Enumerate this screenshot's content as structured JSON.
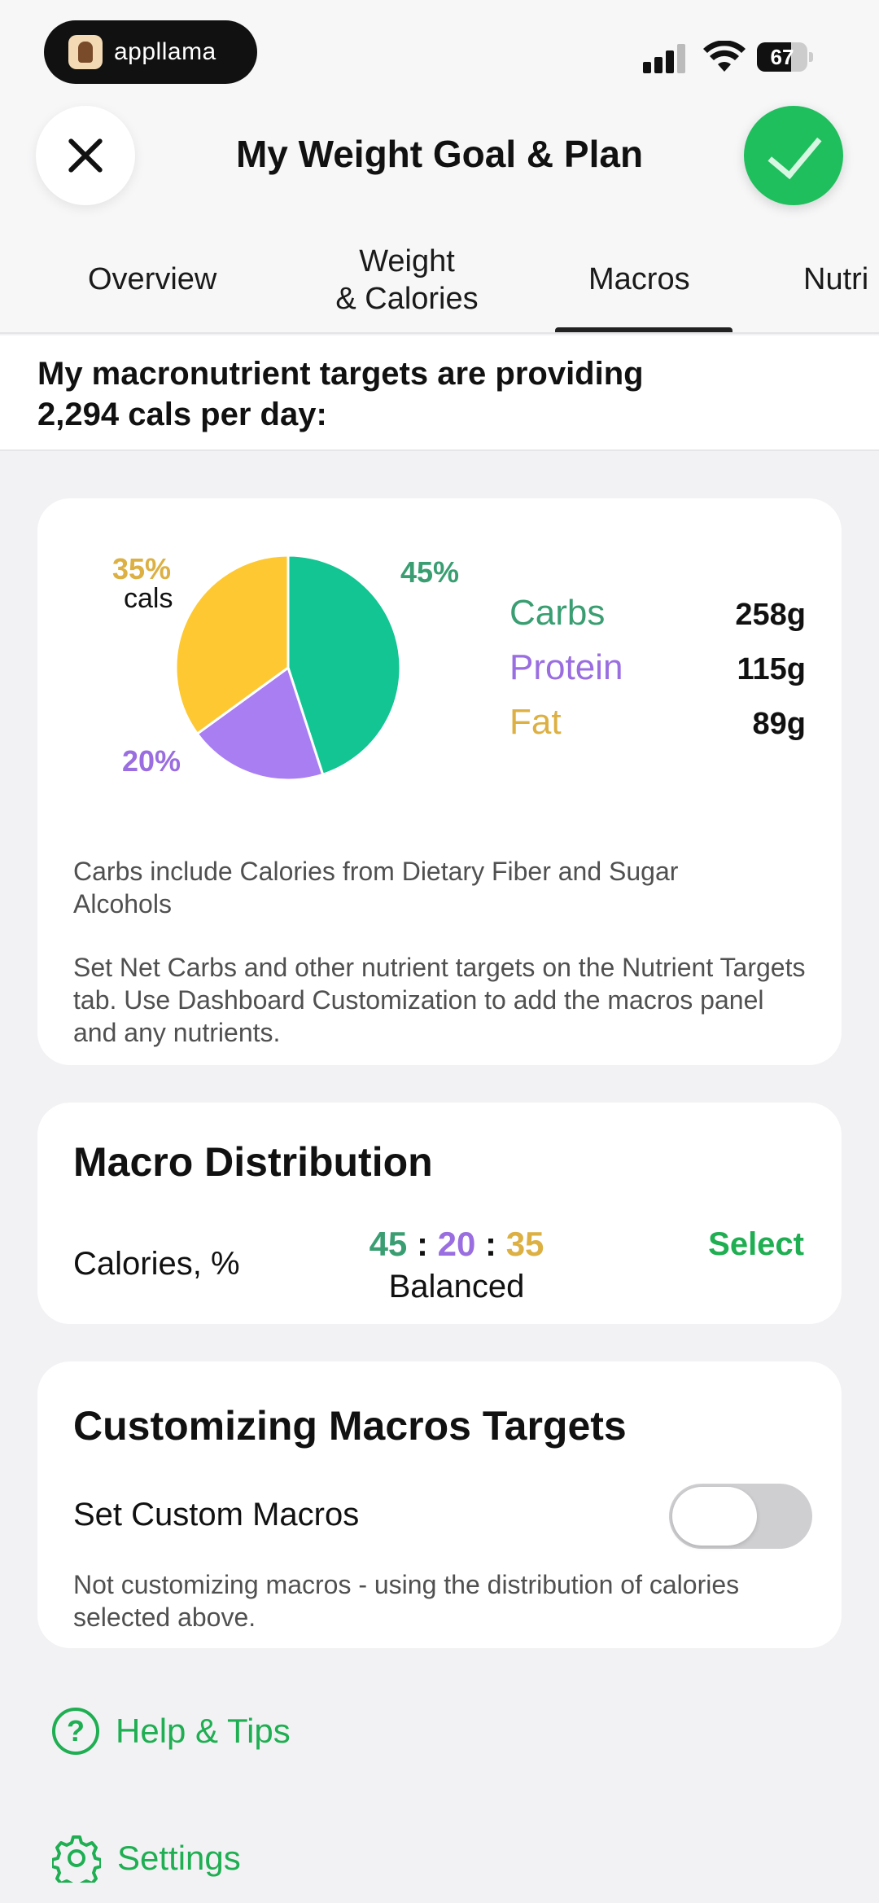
{
  "status_bar": {
    "app_badge": "appllama",
    "battery": "67",
    "battery_level": 0.67
  },
  "header": {
    "title": "My Weight Goal & Plan"
  },
  "tabs": [
    {
      "label": "Overview",
      "active": false
    },
    {
      "label_line1": "Weight",
      "label_line2": "& Calories",
      "active": false
    },
    {
      "label": "Macros",
      "active": true
    },
    {
      "label": "Nutri",
      "active": false
    }
  ],
  "intro": {
    "text": "My macronutrient targets are providing 2,294 cals per day:"
  },
  "macros_card": {
    "pie": {
      "slices": [
        {
          "name": "Carbs",
          "percent": 45,
          "color": "#12c592"
        },
        {
          "name": "Protein",
          "percent": 20,
          "color": "#a97ef2"
        },
        {
          "name": "Fat",
          "percent": 35,
          "color": "#fdc832"
        }
      ],
      "labels": {
        "carbs_pct": "45%",
        "protein_pct": "20%",
        "fat_pct": "35%",
        "fat_sub": "cals"
      }
    },
    "rows": [
      {
        "name": "Carbs",
        "value": "258g",
        "color": "#3a9e72"
      },
      {
        "name": "Protein",
        "value": "115g",
        "color": "#9a6ee0"
      },
      {
        "name": "Fat",
        "value": "89g",
        "color": "#dcb043"
      }
    ],
    "note1": "Carbs include Calories from Dietary Fiber and Sugar Alcohols",
    "note2": "Set Net Carbs and other nutrient targets on the Nutrient Targets tab. Use Dashboard Customization to add the macros panel and any nutrients."
  },
  "distribution_card": {
    "title": "Macro Distribution",
    "label": "Calories, %",
    "ratio": {
      "carbs": "45",
      "protein": "20",
      "fat": "35",
      "sep": ":"
    },
    "ratio_name": "Balanced",
    "select_label": "Select"
  },
  "custom_card": {
    "title": "Customizing Macros Targets",
    "toggle_label": "Set Custom Macros",
    "toggle_on": false,
    "note": "Not customizing macros - using the distribution of calories selected above."
  },
  "links": {
    "help": "Help & Tips",
    "settings": "Settings"
  }
}
